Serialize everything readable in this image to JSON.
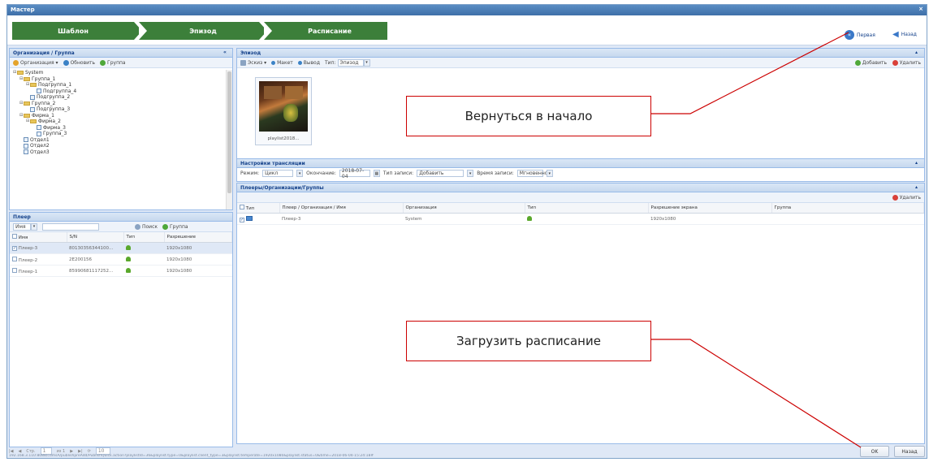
{
  "window": {
    "title": "Мастер",
    "close_glyph": "×"
  },
  "wizard": {
    "steps": [
      "Шаблон",
      "Эпизод",
      "Расписание"
    ],
    "first_label": "Первая",
    "back_label": "Назад",
    "step_color": "#3c7f3a"
  },
  "org_panel": {
    "title": "Организация / Группа",
    "toolbar": {
      "org": "Организация ▾",
      "refresh": "Обновить",
      "group": "Группа"
    },
    "tree": [
      {
        "label": "System",
        "level": 0,
        "type": "folder",
        "exp": "⊟"
      },
      {
        "label": "Группа_1",
        "level": 1,
        "type": "folder",
        "exp": "⊟"
      },
      {
        "label": "Подгруппа_1",
        "level": 2,
        "type": "folder",
        "exp": "⊟"
      },
      {
        "label": "Подгруппа_4",
        "level": 3,
        "type": "leaf",
        "exp": ""
      },
      {
        "label": "Подгруппа_2",
        "level": 2,
        "type": "leaf",
        "exp": ""
      },
      {
        "label": "Группа_2",
        "level": 1,
        "type": "folder",
        "exp": "⊟"
      },
      {
        "label": "Подгруппа_3",
        "level": 2,
        "type": "leaf",
        "exp": ""
      },
      {
        "label": "Фирма_1",
        "level": 1,
        "type": "folder",
        "exp": "⊟"
      },
      {
        "label": "Фирма_2",
        "level": 2,
        "type": "folder",
        "exp": "⊟"
      },
      {
        "label": "Фирма_3",
        "level": 3,
        "type": "leaf",
        "exp": ""
      },
      {
        "label": "Группа_3",
        "level": 3,
        "type": "leaf",
        "exp": ""
      },
      {
        "label": "Отдел1",
        "level": 1,
        "type": "leaf",
        "exp": ""
      },
      {
        "label": "Отдел2",
        "level": 1,
        "type": "leaf",
        "exp": ""
      },
      {
        "label": "Отдел3",
        "level": 1,
        "type": "leaf",
        "exp": ""
      }
    ]
  },
  "player_panel": {
    "title": "Плеер",
    "filter_label": "Имя",
    "search": "Поиск",
    "group": "Группа",
    "columns": [
      "Имя",
      "S/N",
      "Тип",
      "Разрешение"
    ],
    "rows": [
      {
        "checked": true,
        "name": "Плеер-3",
        "sn": "80130356344100...",
        "res": "1920x1080"
      },
      {
        "checked": false,
        "name": "Плеер-2",
        "sn": "2E200156",
        "res": "1920x1080"
      },
      {
        "checked": false,
        "name": "Плеер-1",
        "sn": "85990681117252...",
        "res": "1920x1080"
      }
    ],
    "pager": [
      "Стр.",
      "1",
      "из 1",
      "10"
    ]
  },
  "episode_panel": {
    "title": "Эпизод",
    "toolbar": {
      "mode": "Эскиз ▾",
      "layout": "Макет",
      "view": "Вывод",
      "type_label": "Тип:",
      "type_value": "Эпизод"
    },
    "add": "Добавить",
    "delete": "Удалить",
    "thumbnail_caption": "playlist2018..."
  },
  "broadcast": {
    "title": "Настройки трансляции",
    "mode_label": "Режим:",
    "mode_value": "Цикл",
    "end_label": "Окончание:",
    "end_value": "2018-07-04",
    "record_label": "Тип записи:",
    "record_value": "Добавить",
    "time_label": "Время записи:",
    "time_value": "Мгновенно"
  },
  "players_org": {
    "title": "Плееры/Организации/Группы",
    "delete": "Удалить",
    "columns": [
      "Тип",
      "Плеер / Организация / Имя",
      "Организация",
      "Тип",
      "Разрешение экрана",
      "Группа"
    ],
    "rows": [
      {
        "checked": true,
        "name": "Плеер-3",
        "org": "System",
        "res": "1920x1080",
        "group": ""
      }
    ]
  },
  "callouts": {
    "top": "Вернуться в начало",
    "bottom": "Загрузить расписание",
    "color": "#cc0000"
  },
  "footer": {
    "ok": "OK",
    "back": "Назад",
    "status_url": "192.168.3.110:8088/cdmsA/publishpreAdd/PublishQuick.action?playlistId=36&playlist.type=0&playlist.client_type=3&playlist.temperate=1920x1080&playlist.status=0&time=2018-06-04-15:24:18#"
  }
}
